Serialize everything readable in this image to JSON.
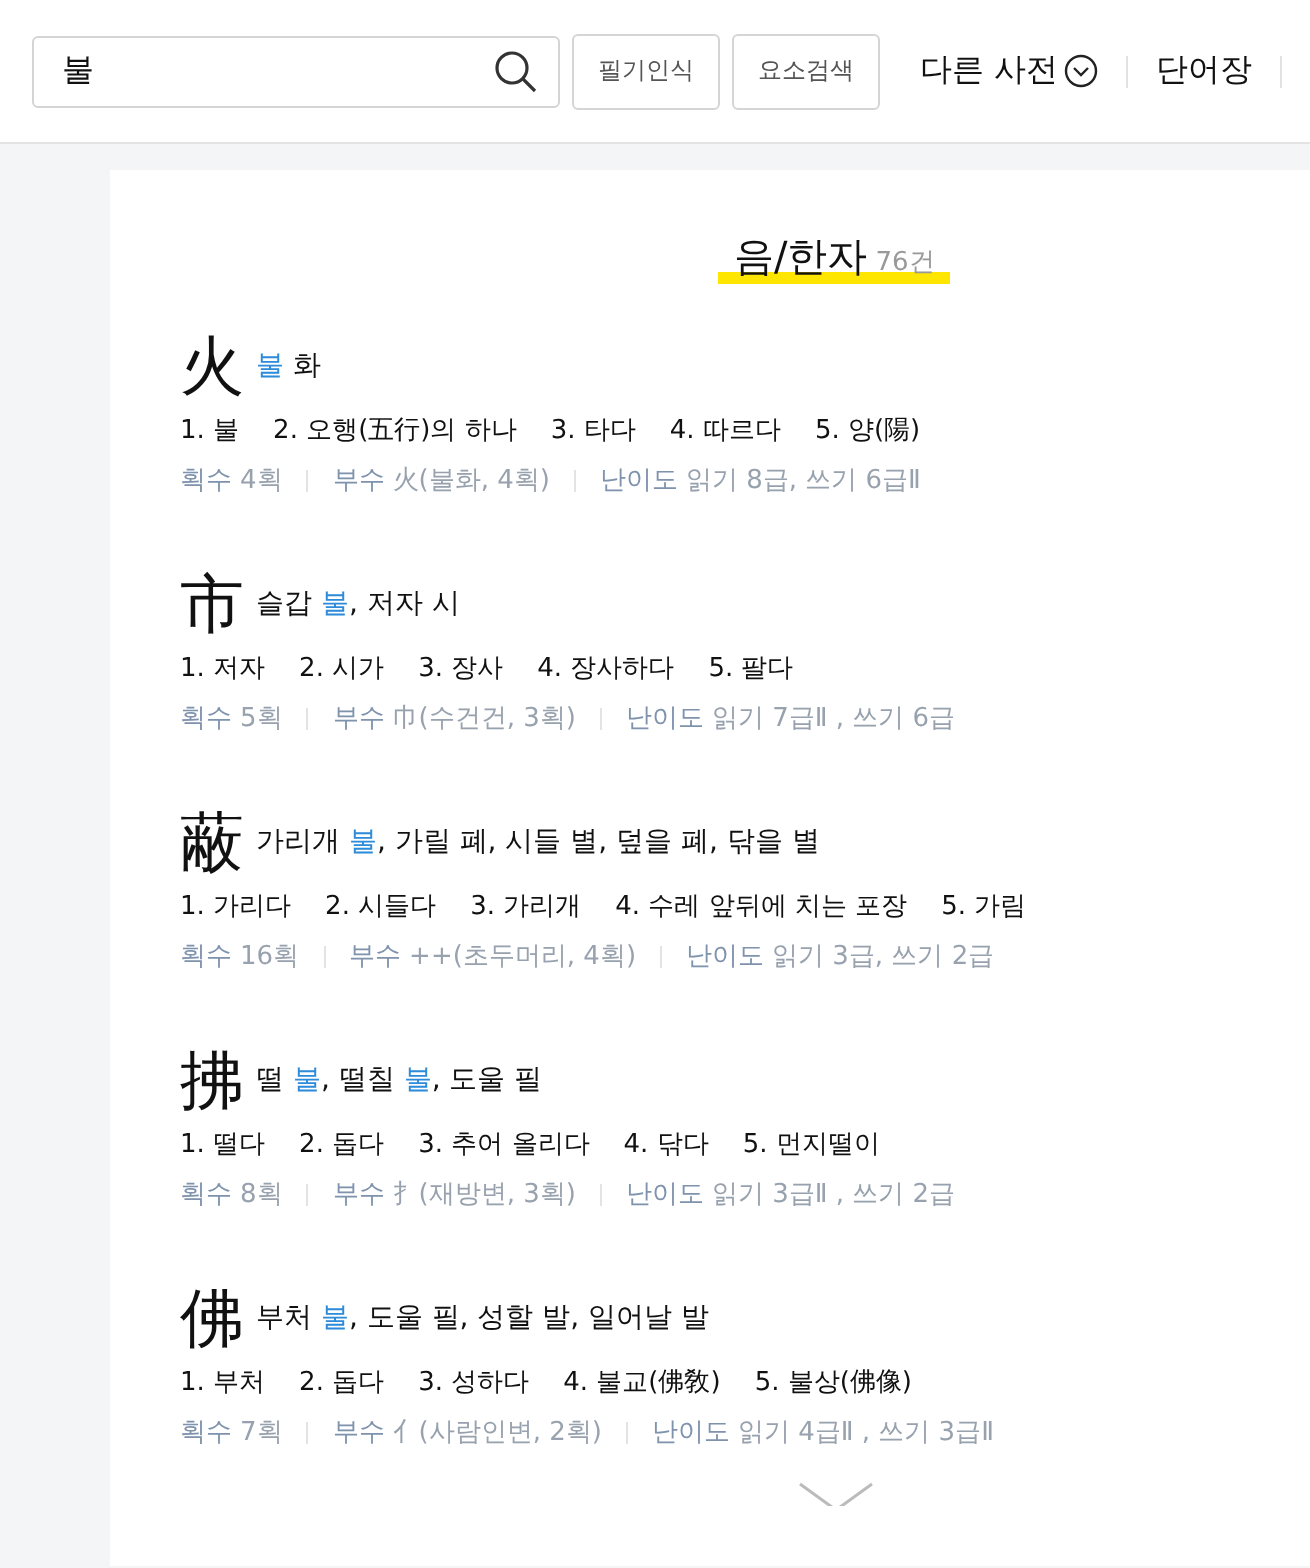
{
  "search": {
    "value": "불"
  },
  "tools": [
    "필기인식",
    "요소검색"
  ],
  "nav": [
    {
      "label": "다른 사전",
      "kind": "dropdown"
    },
    {
      "label": "단어장",
      "kind": "link"
    }
  ],
  "section": {
    "title": "음/한자",
    "count": "76건"
  },
  "entries": [
    {
      "hanja": "火",
      "meaning": [
        {
          "text": "불",
          "highlight": true
        },
        {
          "text": " 화",
          "highlight": false
        }
      ],
      "senses": [
        "1. 불",
        "2. 오행(五行)의 하나",
        "3. 타다",
        "4. 따르다",
        "5. 양(陽)"
      ],
      "stats": [
        {
          "label": "획수",
          "value": "4획"
        },
        {
          "label": "부수",
          "value": "火(불화, 4획)"
        },
        {
          "label": "난이도",
          "value": "읽기 8급, 쓰기 6급Ⅱ"
        }
      ]
    },
    {
      "hanja": "市",
      "meaning": [
        {
          "text": "슬갑 ",
          "highlight": false
        },
        {
          "text": "불",
          "highlight": true
        },
        {
          "text": ", 저자 시",
          "highlight": false
        }
      ],
      "senses": [
        "1. 저자",
        "2. 시가",
        "3. 장사",
        "4. 장사하다",
        "5. 팔다"
      ],
      "stats": [
        {
          "label": "획수",
          "value": "5획"
        },
        {
          "label": "부수",
          "value": "巾(수건건, 3획)"
        },
        {
          "label": "난이도",
          "value": "읽기 7급Ⅱ , 쓰기 6급"
        }
      ]
    },
    {
      "hanja": "蔽",
      "meaning": [
        {
          "text": "가리개 ",
          "highlight": false
        },
        {
          "text": "불",
          "highlight": true
        },
        {
          "text": ", 가릴 폐, 시들 별, 덮을 폐, 닦을 별",
          "highlight": false
        }
      ],
      "senses": [
        "1. 가리다",
        "2. 시들다",
        "3. 가리개",
        "4. 수레 앞뒤에 치는 포장",
        "5. 가림"
      ],
      "stats": [
        {
          "label": "획수",
          "value": "16획"
        },
        {
          "label": "부수",
          "value": "++(초두머리, 4획)"
        },
        {
          "label": "난이도",
          "value": "읽기 3급, 쓰기 2급"
        }
      ]
    },
    {
      "hanja": "拂",
      "meaning": [
        {
          "text": "떨 ",
          "highlight": false
        },
        {
          "text": "불",
          "highlight": true
        },
        {
          "text": ", 떨칠 ",
          "highlight": false
        },
        {
          "text": "불",
          "highlight": true
        },
        {
          "text": ", 도울 필",
          "highlight": false
        }
      ],
      "senses": [
        "1. 떨다",
        "2. 돕다",
        "3. 추어 올리다",
        "4. 닦다",
        "5. 먼지떨이"
      ],
      "stats": [
        {
          "label": "획수",
          "value": "8획"
        },
        {
          "label": "부수",
          "value": "扌(재방변, 3획)"
        },
        {
          "label": "난이도",
          "value": "읽기 3급Ⅱ , 쓰기 2급"
        }
      ]
    },
    {
      "hanja": "佛",
      "meaning": [
        {
          "text": "부처 ",
          "highlight": false
        },
        {
          "text": "불",
          "highlight": true
        },
        {
          "text": ", 도울 필, 성할 발, 일어날 발",
          "highlight": false
        }
      ],
      "senses": [
        "1. 부처",
        "2. 돕다",
        "3. 성하다",
        "4. 불교(佛敎)",
        "5. 불상(佛像)"
      ],
      "stats": [
        {
          "label": "획수",
          "value": "7획"
        },
        {
          "label": "부수",
          "value": "亻(사람인변, 2획)"
        },
        {
          "label": "난이도",
          "value": "읽기 4급Ⅱ , 쓰기 3급Ⅱ"
        }
      ]
    }
  ]
}
